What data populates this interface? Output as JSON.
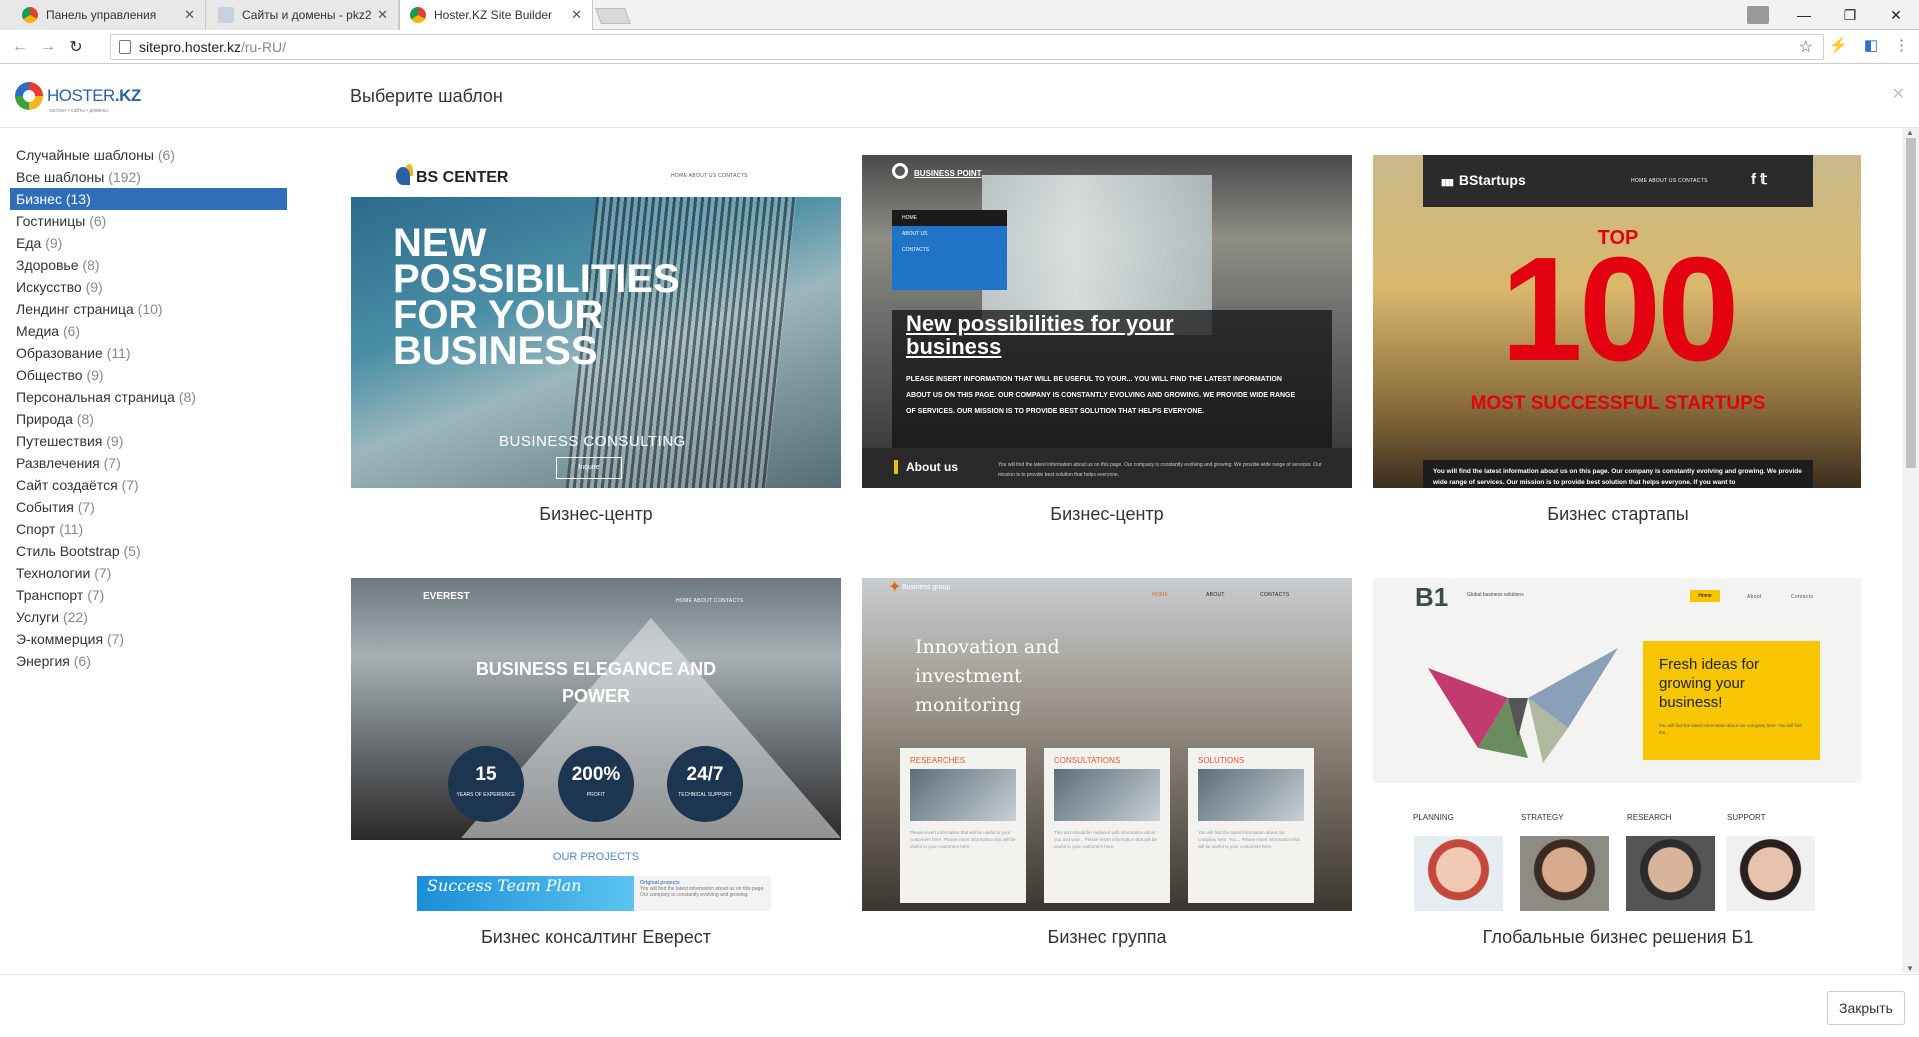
{
  "browser": {
    "tabs": [
      {
        "title": "Панель управления",
        "active": false
      },
      {
        "title": "Сайты и домены - pkz2",
        "active": false
      },
      {
        "title": "Hoster.KZ Site Builder",
        "active": true
      }
    ],
    "url_host": "sitepro.hoster.kz",
    "url_path": "/ru-RU/"
  },
  "modal": {
    "logo_main": "HOSTER",
    "logo_kz": ".KZ",
    "logo_tagline": "хостинг • сайты • домены",
    "title": "Выберите шаблон",
    "close_label": "Закрыть"
  },
  "categories": [
    {
      "label": "Случайные шаблоны",
      "count": "(6)",
      "active": false
    },
    {
      "label": "Все шаблоны",
      "count": "(192)",
      "active": false
    },
    {
      "label": "Бизнес",
      "count": "(13)",
      "active": true
    },
    {
      "label": "Гостиницы",
      "count": "(6)",
      "active": false
    },
    {
      "label": "Еда",
      "count": "(9)",
      "active": false
    },
    {
      "label": "Здоровье",
      "count": "(8)",
      "active": false
    },
    {
      "label": "Искусство",
      "count": "(9)",
      "active": false
    },
    {
      "label": "Лендинг страница",
      "count": "(10)",
      "active": false
    },
    {
      "label": "Медиа",
      "count": "(6)",
      "active": false
    },
    {
      "label": "Образование",
      "count": "(11)",
      "active": false
    },
    {
      "label": "Общество",
      "count": "(9)",
      "active": false
    },
    {
      "label": "Персональная страница",
      "count": "(8)",
      "active": false
    },
    {
      "label": "Природа",
      "count": "(8)",
      "active": false
    },
    {
      "label": "Путешествия",
      "count": "(9)",
      "active": false
    },
    {
      "label": "Развлечения",
      "count": "(7)",
      "active": false
    },
    {
      "label": "Сайт создаётся",
      "count": "(7)",
      "active": false
    },
    {
      "label": "События",
      "count": "(7)",
      "active": false
    },
    {
      "label": "Спорт",
      "count": "(11)",
      "active": false
    },
    {
      "label": "Стиль Bootstrap",
      "count": "(5)",
      "active": false
    },
    {
      "label": "Технологии",
      "count": "(7)",
      "active": false
    },
    {
      "label": "Транспорт",
      "count": "(7)",
      "active": false
    },
    {
      "label": "Услуги",
      "count": "(22)",
      "active": false
    },
    {
      "label": "Э-коммерция",
      "count": "(7)",
      "active": false
    },
    {
      "label": "Энергия",
      "count": "(6)",
      "active": false
    }
  ],
  "templates": [
    {
      "name": "Бизнес-центр",
      "logo": "BS CENTER",
      "nav": "HOME      ABOUT US      CONTACTS",
      "headline": "NEW POSSIBILITIES FOR YOUR BUSINESS",
      "sub": "BUSINESS CONSULTING",
      "button": "Inquire"
    },
    {
      "name": "Бизнес-центр",
      "logo": "BUSINESS POINT",
      "menu": [
        "HOME",
        "ABOUT US",
        "CONTACTS"
      ],
      "headline": "New possibilities for your business",
      "body": "PLEASE INSERT INFORMATION THAT WILL BE USEFUL TO YOUR... YOU WILL FIND THE LATEST INFORMATION ABOUT US ON THIS PAGE. OUR COMPANY IS CONSTANTLY EVOLVING AND GROWING. WE PROVIDE WIDE RANGE OF SERVICES. OUR MISSION IS TO PROVIDE BEST SOLUTION THAT HELPS EVERYONE.",
      "about": "About us",
      "about_text": "You will find the latest information about us on this page. Our company is constantly evolving and growing. We provide wide range of services. Our mission is to provide best solution that helps everyone."
    },
    {
      "name": "Бизнес стартапы",
      "logo": "BStartups",
      "nav": "HOME     ABOUT US     CONTACTS",
      "social": "f  𝕥",
      "top": "TOP",
      "big": "100",
      "most": "MOST SUCCESSFUL STARTUPS",
      "strip": "You will find the latest information about us on this page. Our company is constantly evolving and growing. We provide wide range of services. Our mission is to provide best solution that helps everyone. If you want to"
    },
    {
      "name": "Бизнес консалтинг Еверест",
      "logo": "EVEREST",
      "nav": "HOME     ABOUT     CONTACTS",
      "headline": "BUSINESS ELEGANCE AND POWER",
      "stats": [
        {
          "n": "15",
          "l": "YEARS OF EXPERIENCE"
        },
        {
          "n": "200%",
          "l": "PROFIT"
        },
        {
          "n": "24/7",
          "l": "TECHNICAL SUPPORT"
        }
      ],
      "projects": "OUR PROJECTS",
      "project_img_text": "Success  Team  Plan",
      "project_title": "Original projects",
      "project_text": "You will find the latest information about us on this page. Our company is constantly evolving and growing."
    },
    {
      "name": "Бизнес группа",
      "logo": "Business group",
      "nav": [
        "HOME",
        "ABOUT",
        "CONTACTS"
      ],
      "headline": "Innovation and investment monitoring",
      "boxes": [
        {
          "h": "RESEARCHES",
          "p": "Please insert information that will be useful to your customers here. Please insert information that will be useful to your customers here."
        },
        {
          "h": "CONSULTATIONS",
          "p": "This text should be replaced with information about you and your... Please insert information that will be useful to your customers here."
        },
        {
          "h": "SOLUTIONS",
          "p": "You will find the latest information about our company here. You... Please insert information that will be useful to your customers here."
        }
      ]
    },
    {
      "name": "Глобальные бизнес решения Б1",
      "logo": "B1",
      "logo_sub": "Global business solutions",
      "nav": [
        "Home",
        "About",
        "Contacts"
      ],
      "yellow_head": "Fresh ideas for growing your business!",
      "yellow_text": "You will find the latest information about our company here. You will find the...",
      "labels": [
        "PLANNING",
        "STRATEGY",
        "RESEARCH",
        "SUPPORT"
      ]
    }
  ],
  "colors": {
    "accent": "#2f6fba",
    "brand_red": "#e3000f",
    "brand_yellow": "#f7c600"
  }
}
